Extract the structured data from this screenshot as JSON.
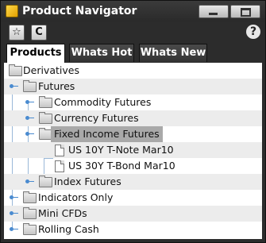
{
  "window": {
    "title": "Product Navigator",
    "icon": "app-square-icon"
  },
  "toolbar": {
    "favorite_icon": "star-icon",
    "refresh_icon": "refresh-icon",
    "favorite_glyph": "☆",
    "refresh_glyph": "C",
    "help_glyph": "?"
  },
  "tabs": [
    {
      "label": "Products",
      "active": true
    },
    {
      "label": "Whats Hot",
      "active": false
    },
    {
      "label": "Whats New",
      "active": false
    }
  ],
  "tree": [
    {
      "label": "Derivatives",
      "level": 0,
      "type": "folder",
      "toggle": false
    },
    {
      "label": "Futures",
      "level": 1,
      "type": "folder",
      "toggle": true
    },
    {
      "label": "Commodity Futures",
      "level": 2,
      "type": "folder",
      "toggle": true
    },
    {
      "label": "Currency Futures",
      "level": 2,
      "type": "folder",
      "toggle": true
    },
    {
      "label": "Fixed Income Futures",
      "level": 2,
      "type": "folder",
      "toggle": true,
      "selected": true
    },
    {
      "label": "US 10Y T-Note Mar10",
      "level": 3,
      "type": "doc",
      "toggle": false
    },
    {
      "label": "US 30Y T-Bond Mar10",
      "level": 3,
      "type": "doc",
      "toggle": false
    },
    {
      "label": "Index Futures",
      "level": 2,
      "type": "folder",
      "toggle": true
    },
    {
      "label": "Indicators Only",
      "level": 1,
      "type": "folder",
      "toggle": true
    },
    {
      "label": "Mini CFDs",
      "level": 1,
      "type": "folder",
      "toggle": true
    },
    {
      "label": "Rolling Cash",
      "level": 1,
      "type": "folder",
      "toggle": true
    }
  ]
}
